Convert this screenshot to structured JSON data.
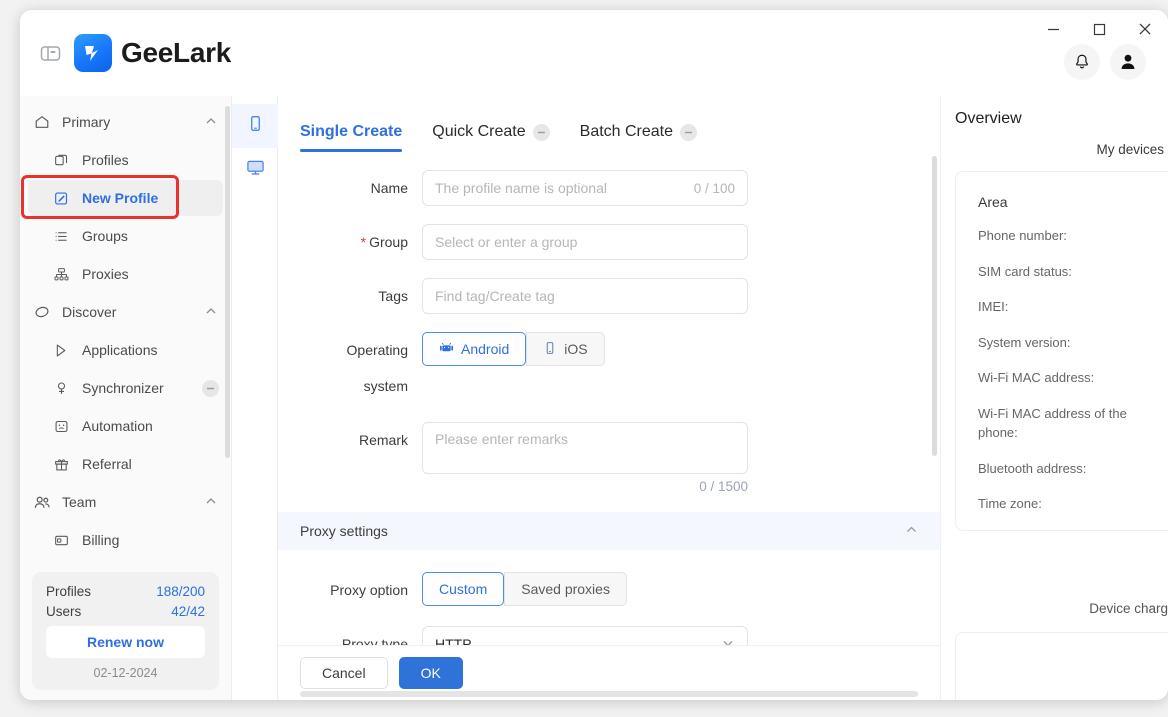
{
  "window": {
    "minimize_label": "Minimize",
    "maximize_label": "Maximize",
    "close_label": "Close"
  },
  "header": {
    "brand_name": "GeeLark",
    "panel_toggle_name": "Toggle sidebar",
    "notifications_label": "Notifications",
    "account_label": "Account"
  },
  "sidebar": {
    "groups": [
      {
        "label": "Primary",
        "icon": "home-icon",
        "collapsed": false,
        "items": [
          {
            "label": "Profiles",
            "icon": "profiles-icon",
            "active": false,
            "badge": false
          },
          {
            "label": "New Profile",
            "icon": "new-profile-icon",
            "active": true,
            "badge": false
          },
          {
            "label": "Groups",
            "icon": "groups-icon",
            "active": false,
            "badge": false
          },
          {
            "label": "Proxies",
            "icon": "proxies-icon",
            "active": false,
            "badge": false
          }
        ]
      },
      {
        "label": "Discover",
        "icon": "discover-icon",
        "collapsed": false,
        "items": [
          {
            "label": "Applications",
            "icon": "applications-icon",
            "active": false,
            "badge": false
          },
          {
            "label": "Synchronizer",
            "icon": "synchronizer-icon",
            "active": false,
            "badge": true
          },
          {
            "label": "Automation",
            "icon": "automation-icon",
            "active": false,
            "badge": false
          },
          {
            "label": "Referral",
            "icon": "referral-icon",
            "active": false,
            "badge": false
          }
        ]
      },
      {
        "label": "Team",
        "icon": "team-icon",
        "collapsed": false,
        "items": [
          {
            "label": "Billing",
            "icon": "billing-icon",
            "active": false,
            "badge": false
          }
        ]
      }
    ],
    "plan": {
      "profiles_label": "Profiles",
      "profiles_value": "188/200",
      "users_label": "Users",
      "users_value": "42/42",
      "renew_label": "Renew now",
      "expiry_date": "02-12-2024"
    }
  },
  "rail": {
    "items": [
      {
        "name": "phone-device-icon",
        "active": true
      },
      {
        "name": "desktop-device-icon",
        "active": false
      }
    ]
  },
  "main": {
    "tabs": [
      {
        "label": "Single Create",
        "active": true,
        "badge": false
      },
      {
        "label": "Quick Create",
        "active": false,
        "badge": true
      },
      {
        "label": "Batch Create",
        "active": false,
        "badge": true
      }
    ],
    "fields": {
      "name_label": "Name",
      "name_placeholder": "The profile name is optional",
      "name_counter": "0 / 100",
      "group_label": "Group",
      "group_required": "*",
      "group_placeholder": "Select or enter a group",
      "tags_label": "Tags",
      "tags_placeholder": "Find tag/Create tag",
      "os_label": "Operating system",
      "os_android": "Android",
      "os_ios": "iOS",
      "os_selected": "Android",
      "remark_label": "Remark",
      "remark_placeholder": "Please enter remarks",
      "remark_counter": "0 / 1500"
    },
    "proxy_section": {
      "title": "Proxy settings",
      "option_label": "Proxy option",
      "option_custom": "Custom",
      "option_saved": "Saved proxies",
      "option_selected": "Custom",
      "type_label": "Proxy type",
      "type_value": "HTTP"
    },
    "footer": {
      "cancel_label": "Cancel",
      "ok_label": "OK"
    }
  },
  "overview": {
    "title": "Overview",
    "subtitle": "My devices",
    "area_label": "Area",
    "lines": [
      "Phone number:",
      "SIM card status:",
      "IMEI:",
      "System version:",
      "Wi-Fi MAC address:",
      "Wi-Fi MAC address of the phone:",
      "Bluetooth address:",
      "Time zone:"
    ],
    "device_charge": "Device charg"
  }
}
